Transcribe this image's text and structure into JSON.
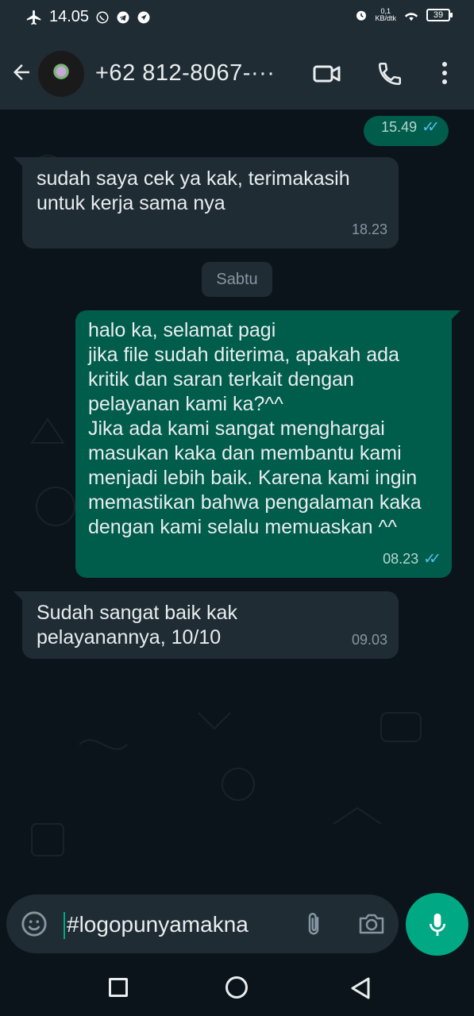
{
  "status_bar": {
    "time": "14.05",
    "net_speed_value": "0,1",
    "net_speed_unit": "KB/dtk",
    "battery": "39",
    "icons": [
      "airplane-icon",
      "whatsapp-icon",
      "telegram-icon",
      "navigation-icon",
      "alarm-icon",
      "wifi-icon",
      "battery-icon"
    ]
  },
  "header": {
    "contact_name": "+62 812-8067-···",
    "icons": [
      "back-arrow-icon",
      "avatar",
      "video-call-icon",
      "voice-call-icon",
      "more-options-icon"
    ]
  },
  "messages": [
    {
      "direction": "out",
      "text": "",
      "time": "15.49",
      "status": "read"
    },
    {
      "direction": "in",
      "text": "sudah saya cek ya kak, terimakasih untuk kerja sama nya",
      "time": "18.23"
    },
    {
      "direction": "out",
      "text": "halo ka, selamat pagi\njika file sudah diterima, apakah ada kritik dan saran terkait dengan pelayanan kami ka?^^\nJika ada kami sangat menghargai masukan kaka dan membantu kami menjadi lebih baik. Karena kami ingin memastikan bahwa pengalaman kaka dengan kami selalu memuaskan ^^",
      "time": "08.23",
      "status": "read"
    },
    {
      "direction": "in",
      "text": "Sudah sangat baik kak pelayanannya, 10/10",
      "time": "09.03"
    }
  ],
  "date_divider": "Sabtu",
  "composer": {
    "value": "#logopunyamakna",
    "icons": [
      "emoji-icon",
      "attach-icon",
      "camera-icon",
      "mic-icon"
    ]
  },
  "colors": {
    "background": "#0b141a",
    "bar": "#1f2c34",
    "incoming_bubble": "#1f2c34",
    "outgoing_bubble": "#005c4b",
    "accent": "#00a884",
    "read_ticks": "#53bdeb"
  }
}
